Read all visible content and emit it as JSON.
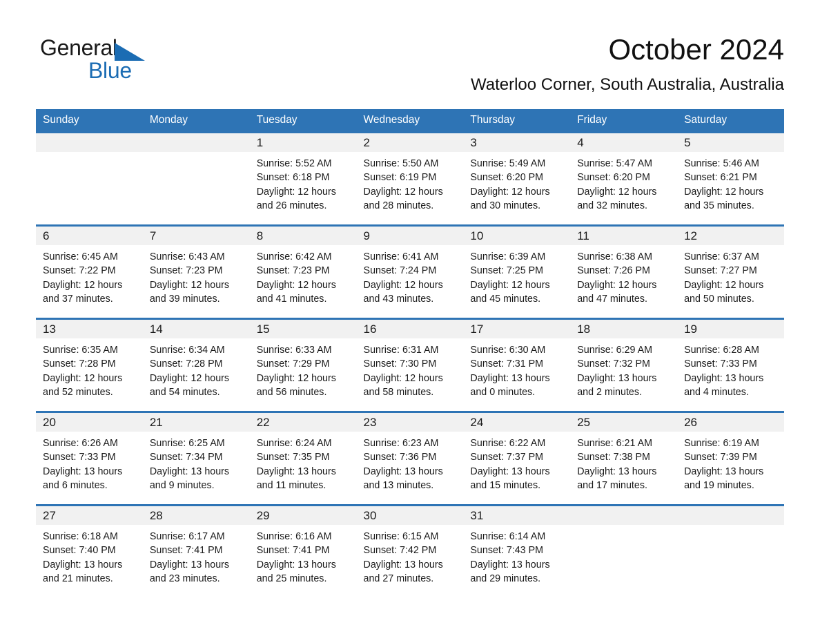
{
  "brand": {
    "name_part1": "General",
    "name_part2": "Blue",
    "accent_color": "#1b6cb3"
  },
  "header": {
    "title": "October 2024",
    "subtitle": "Waterloo Corner, South Australia, Australia",
    "header_bg_color": "#2e74b5",
    "daynum_band_color": "#f1f1f1"
  },
  "calendar": {
    "weekdays": [
      "Sunday",
      "Monday",
      "Tuesday",
      "Wednesday",
      "Thursday",
      "Friday",
      "Saturday"
    ],
    "weeks": [
      [
        {
          "day": "",
          "sunrise": "",
          "sunset": "",
          "daylight_l1": "",
          "daylight_l2": ""
        },
        {
          "day": "",
          "sunrise": "",
          "sunset": "",
          "daylight_l1": "",
          "daylight_l2": ""
        },
        {
          "day": "1",
          "sunrise": "Sunrise: 5:52 AM",
          "sunset": "Sunset: 6:18 PM",
          "daylight_l1": "Daylight: 12 hours",
          "daylight_l2": "and 26 minutes."
        },
        {
          "day": "2",
          "sunrise": "Sunrise: 5:50 AM",
          "sunset": "Sunset: 6:19 PM",
          "daylight_l1": "Daylight: 12 hours",
          "daylight_l2": "and 28 minutes."
        },
        {
          "day": "3",
          "sunrise": "Sunrise: 5:49 AM",
          "sunset": "Sunset: 6:20 PM",
          "daylight_l1": "Daylight: 12 hours",
          "daylight_l2": "and 30 minutes."
        },
        {
          "day": "4",
          "sunrise": "Sunrise: 5:47 AM",
          "sunset": "Sunset: 6:20 PM",
          "daylight_l1": "Daylight: 12 hours",
          "daylight_l2": "and 32 minutes."
        },
        {
          "day": "5",
          "sunrise": "Sunrise: 5:46 AM",
          "sunset": "Sunset: 6:21 PM",
          "daylight_l1": "Daylight: 12 hours",
          "daylight_l2": "and 35 minutes."
        }
      ],
      [
        {
          "day": "6",
          "sunrise": "Sunrise: 6:45 AM",
          "sunset": "Sunset: 7:22 PM",
          "daylight_l1": "Daylight: 12 hours",
          "daylight_l2": "and 37 minutes."
        },
        {
          "day": "7",
          "sunrise": "Sunrise: 6:43 AM",
          "sunset": "Sunset: 7:23 PM",
          "daylight_l1": "Daylight: 12 hours",
          "daylight_l2": "and 39 minutes."
        },
        {
          "day": "8",
          "sunrise": "Sunrise: 6:42 AM",
          "sunset": "Sunset: 7:23 PM",
          "daylight_l1": "Daylight: 12 hours",
          "daylight_l2": "and 41 minutes."
        },
        {
          "day": "9",
          "sunrise": "Sunrise: 6:41 AM",
          "sunset": "Sunset: 7:24 PM",
          "daylight_l1": "Daylight: 12 hours",
          "daylight_l2": "and 43 minutes."
        },
        {
          "day": "10",
          "sunrise": "Sunrise: 6:39 AM",
          "sunset": "Sunset: 7:25 PM",
          "daylight_l1": "Daylight: 12 hours",
          "daylight_l2": "and 45 minutes."
        },
        {
          "day": "11",
          "sunrise": "Sunrise: 6:38 AM",
          "sunset": "Sunset: 7:26 PM",
          "daylight_l1": "Daylight: 12 hours",
          "daylight_l2": "and 47 minutes."
        },
        {
          "day": "12",
          "sunrise": "Sunrise: 6:37 AM",
          "sunset": "Sunset: 7:27 PM",
          "daylight_l1": "Daylight: 12 hours",
          "daylight_l2": "and 50 minutes."
        }
      ],
      [
        {
          "day": "13",
          "sunrise": "Sunrise: 6:35 AM",
          "sunset": "Sunset: 7:28 PM",
          "daylight_l1": "Daylight: 12 hours",
          "daylight_l2": "and 52 minutes."
        },
        {
          "day": "14",
          "sunrise": "Sunrise: 6:34 AM",
          "sunset": "Sunset: 7:28 PM",
          "daylight_l1": "Daylight: 12 hours",
          "daylight_l2": "and 54 minutes."
        },
        {
          "day": "15",
          "sunrise": "Sunrise: 6:33 AM",
          "sunset": "Sunset: 7:29 PM",
          "daylight_l1": "Daylight: 12 hours",
          "daylight_l2": "and 56 minutes."
        },
        {
          "day": "16",
          "sunrise": "Sunrise: 6:31 AM",
          "sunset": "Sunset: 7:30 PM",
          "daylight_l1": "Daylight: 12 hours",
          "daylight_l2": "and 58 minutes."
        },
        {
          "day": "17",
          "sunrise": "Sunrise: 6:30 AM",
          "sunset": "Sunset: 7:31 PM",
          "daylight_l1": "Daylight: 13 hours",
          "daylight_l2": "and 0 minutes."
        },
        {
          "day": "18",
          "sunrise": "Sunrise: 6:29 AM",
          "sunset": "Sunset: 7:32 PM",
          "daylight_l1": "Daylight: 13 hours",
          "daylight_l2": "and 2 minutes."
        },
        {
          "day": "19",
          "sunrise": "Sunrise: 6:28 AM",
          "sunset": "Sunset: 7:33 PM",
          "daylight_l1": "Daylight: 13 hours",
          "daylight_l2": "and 4 minutes."
        }
      ],
      [
        {
          "day": "20",
          "sunrise": "Sunrise: 6:26 AM",
          "sunset": "Sunset: 7:33 PM",
          "daylight_l1": "Daylight: 13 hours",
          "daylight_l2": "and 6 minutes."
        },
        {
          "day": "21",
          "sunrise": "Sunrise: 6:25 AM",
          "sunset": "Sunset: 7:34 PM",
          "daylight_l1": "Daylight: 13 hours",
          "daylight_l2": "and 9 minutes."
        },
        {
          "day": "22",
          "sunrise": "Sunrise: 6:24 AM",
          "sunset": "Sunset: 7:35 PM",
          "daylight_l1": "Daylight: 13 hours",
          "daylight_l2": "and 11 minutes."
        },
        {
          "day": "23",
          "sunrise": "Sunrise: 6:23 AM",
          "sunset": "Sunset: 7:36 PM",
          "daylight_l1": "Daylight: 13 hours",
          "daylight_l2": "and 13 minutes."
        },
        {
          "day": "24",
          "sunrise": "Sunrise: 6:22 AM",
          "sunset": "Sunset: 7:37 PM",
          "daylight_l1": "Daylight: 13 hours",
          "daylight_l2": "and 15 minutes."
        },
        {
          "day": "25",
          "sunrise": "Sunrise: 6:21 AM",
          "sunset": "Sunset: 7:38 PM",
          "daylight_l1": "Daylight: 13 hours",
          "daylight_l2": "and 17 minutes."
        },
        {
          "day": "26",
          "sunrise": "Sunrise: 6:19 AM",
          "sunset": "Sunset: 7:39 PM",
          "daylight_l1": "Daylight: 13 hours",
          "daylight_l2": "and 19 minutes."
        }
      ],
      [
        {
          "day": "27",
          "sunrise": "Sunrise: 6:18 AM",
          "sunset": "Sunset: 7:40 PM",
          "daylight_l1": "Daylight: 13 hours",
          "daylight_l2": "and 21 minutes."
        },
        {
          "day": "28",
          "sunrise": "Sunrise: 6:17 AM",
          "sunset": "Sunset: 7:41 PM",
          "daylight_l1": "Daylight: 13 hours",
          "daylight_l2": "and 23 minutes."
        },
        {
          "day": "29",
          "sunrise": "Sunrise: 6:16 AM",
          "sunset": "Sunset: 7:41 PM",
          "daylight_l1": "Daylight: 13 hours",
          "daylight_l2": "and 25 minutes."
        },
        {
          "day": "30",
          "sunrise": "Sunrise: 6:15 AM",
          "sunset": "Sunset: 7:42 PM",
          "daylight_l1": "Daylight: 13 hours",
          "daylight_l2": "and 27 minutes."
        },
        {
          "day": "31",
          "sunrise": "Sunrise: 6:14 AM",
          "sunset": "Sunset: 7:43 PM",
          "daylight_l1": "Daylight: 13 hours",
          "daylight_l2": "and 29 minutes."
        },
        {
          "day": "",
          "sunrise": "",
          "sunset": "",
          "daylight_l1": "",
          "daylight_l2": ""
        },
        {
          "day": "",
          "sunrise": "",
          "sunset": "",
          "daylight_l1": "",
          "daylight_l2": ""
        }
      ]
    ]
  }
}
